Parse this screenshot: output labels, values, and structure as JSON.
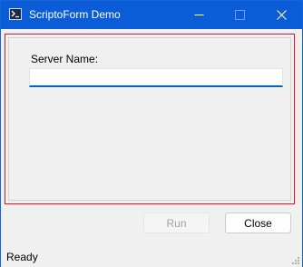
{
  "window": {
    "title": "ScriptoForm Demo"
  },
  "icons": {
    "app": "powershell-icon",
    "minimize": "minimize-icon",
    "maximize": "maximize-icon",
    "close": "close-icon"
  },
  "form": {
    "server_label": "Server Name:",
    "server_value": ""
  },
  "buttons": {
    "run_label": "Run",
    "close_label": "Close"
  },
  "status": {
    "text": "Ready"
  },
  "colors": {
    "titlebar": "#0a5dd6",
    "panel_border": "#e81123",
    "input_focus": "#0067c0"
  }
}
